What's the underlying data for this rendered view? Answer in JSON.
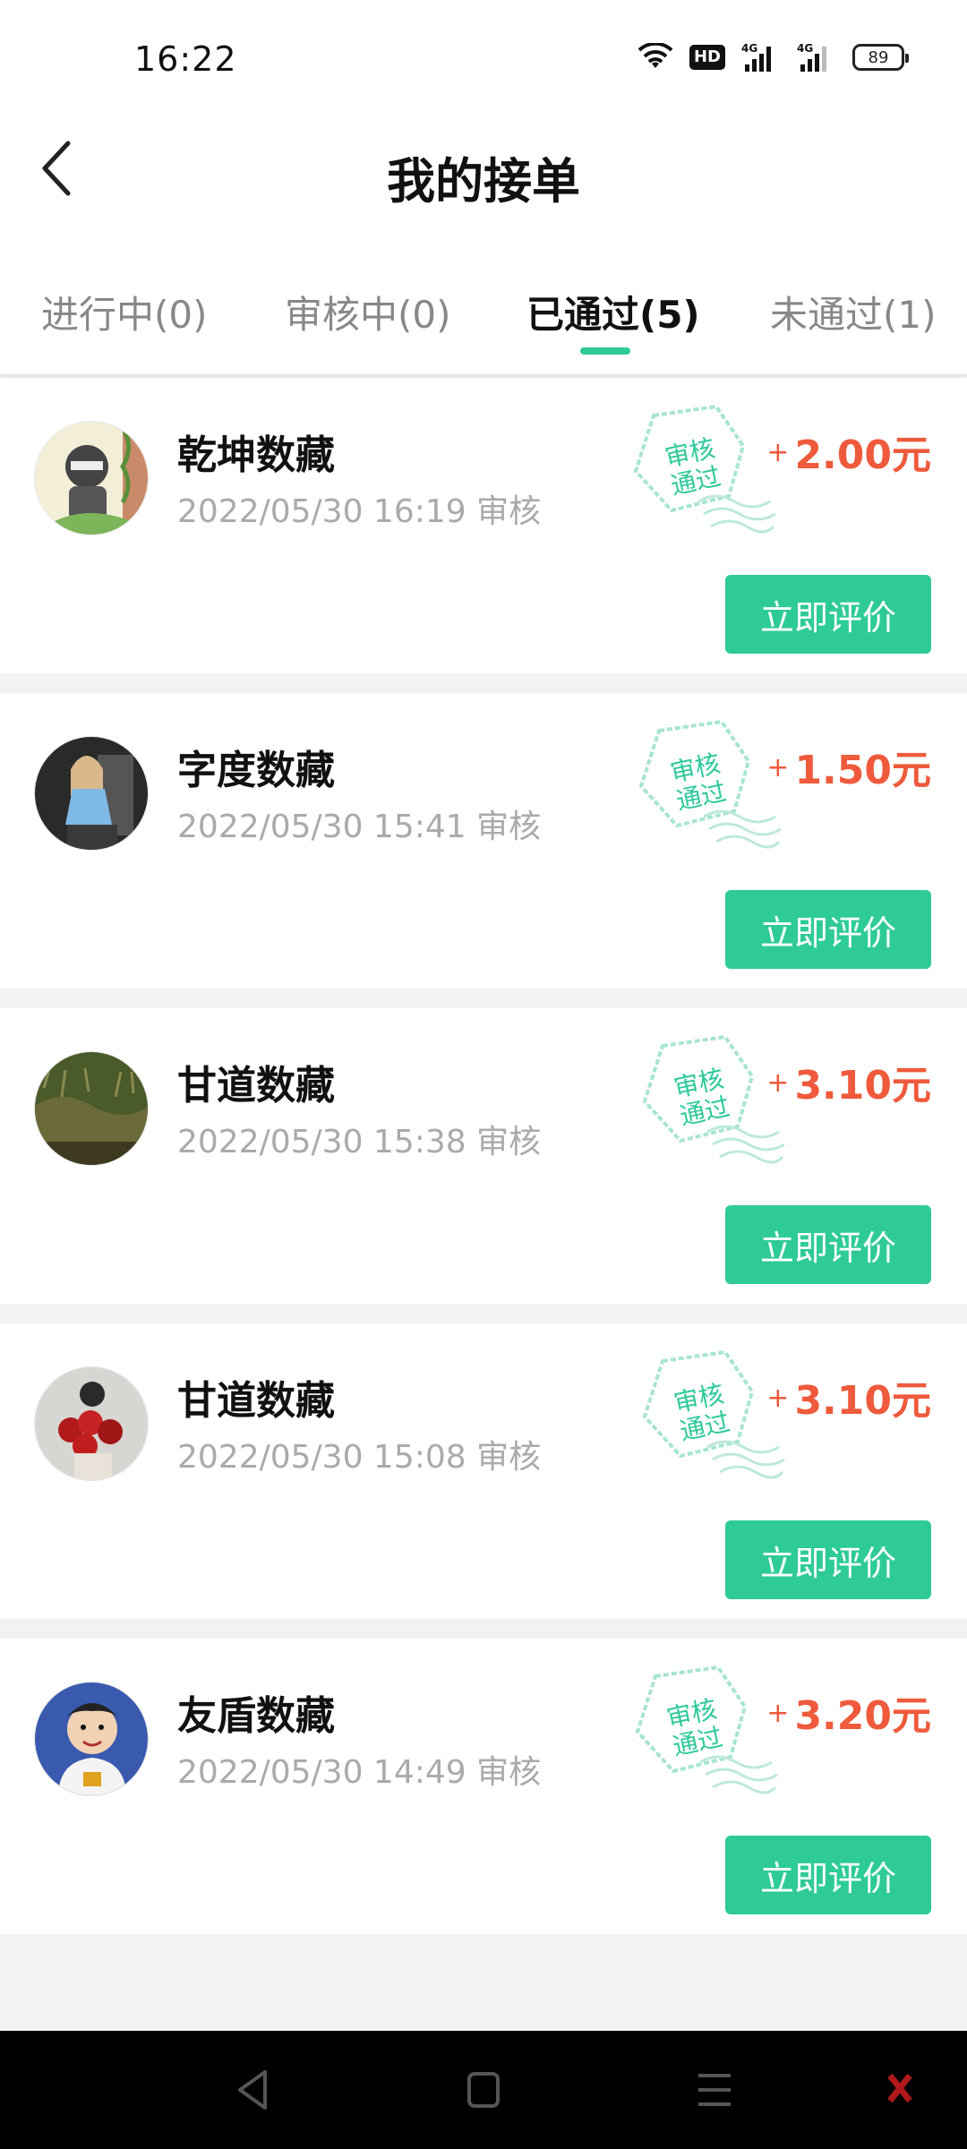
{
  "status_bar": {
    "time": "16:22",
    "hd_label": "HD",
    "network_1": "4G",
    "network_2": "4G",
    "battery": "89"
  },
  "header": {
    "title": "我的接单",
    "back_icon": "chevron-left-icon"
  },
  "tabs": [
    {
      "label": "进行中(0)",
      "active": false
    },
    {
      "label": "审核中(0)",
      "active": false
    },
    {
      "label": "已通过(5)",
      "active": true
    },
    {
      "label": "未通过(1)",
      "active": false
    }
  ],
  "orders": [
    {
      "name": "乾坤数藏",
      "time": "2022/05/30 16:19 审核",
      "amount": "2.00元",
      "stamp": [
        "审核",
        "通过"
      ],
      "button": "立即评价"
    },
    {
      "name": "字度数藏",
      "time": "2022/05/30 15:41 审核",
      "amount": "1.50元",
      "stamp": [
        "审核",
        "通过"
      ],
      "button": "立即评价"
    },
    {
      "name": "甘道数藏",
      "time": "2022/05/30 15:38 审核",
      "amount": "3.10元",
      "stamp": [
        "审核",
        "通过"
      ],
      "button": "立即评价"
    },
    {
      "name": "甘道数藏",
      "time": "2022/05/30 15:08 审核",
      "amount": "3.10元",
      "stamp": [
        "审核",
        "通过"
      ],
      "button": "立即评价"
    },
    {
      "name": "友盾数藏",
      "time": "2022/05/30 14:49 审核",
      "amount": "3.20元",
      "stamp": [
        "审核",
        "通过"
      ],
      "button": "立即评价"
    }
  ],
  "amount_prefix": "+",
  "colors": {
    "accent": "#2ecc94",
    "amount": "#ef5a3c",
    "stamp": "#2ec99a"
  }
}
